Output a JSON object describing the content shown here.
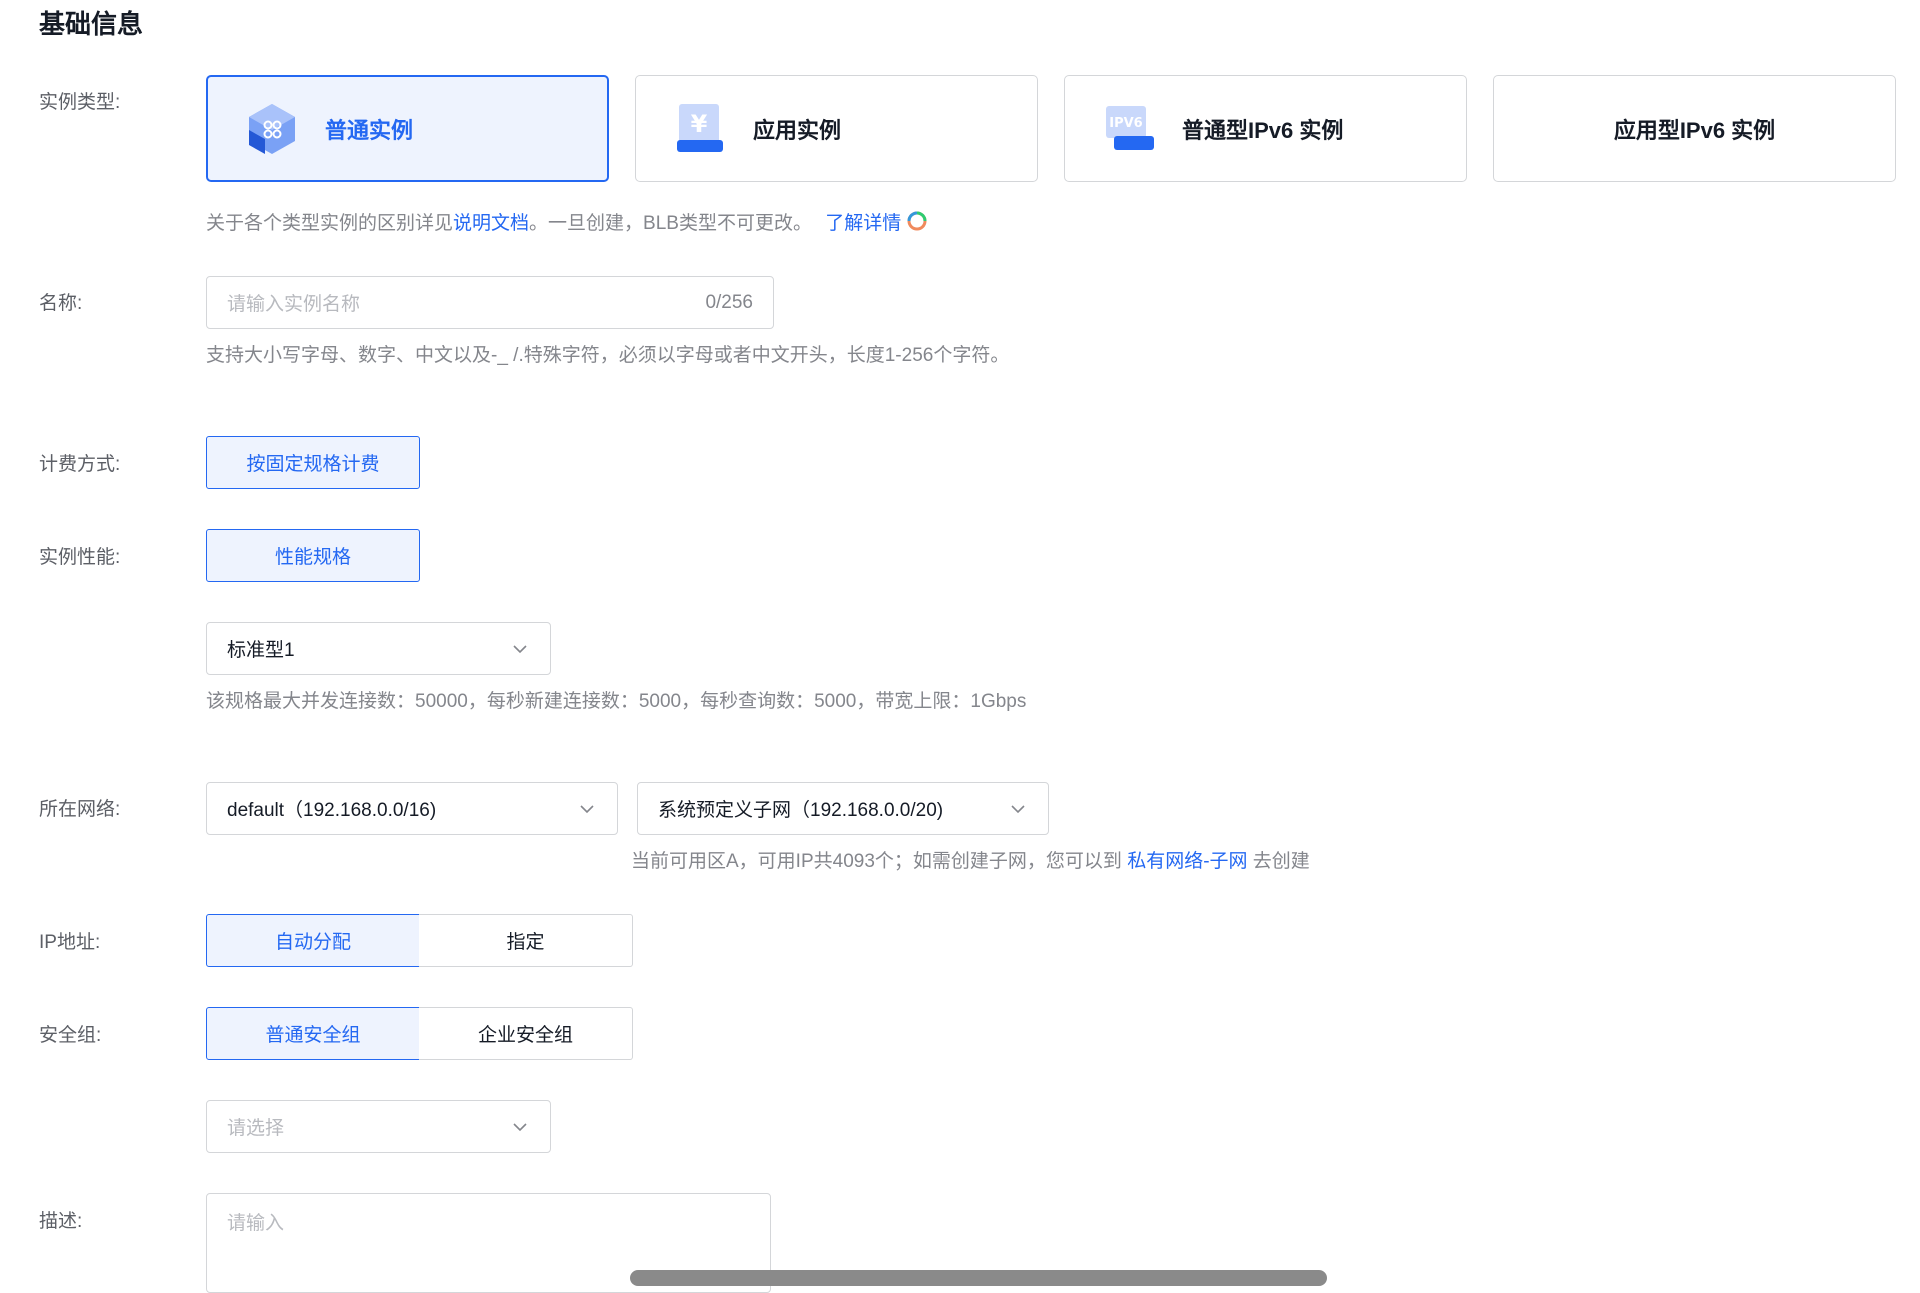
{
  "section_title": "基础信息",
  "labels": {
    "instance_type": "实例类型:",
    "name": "名称:",
    "billing": "计费方式:",
    "performance": "实例性能:",
    "network": "所在网络:",
    "ip": "IP地址:",
    "security": "安全组:",
    "description": "描述:"
  },
  "instance_types": [
    {
      "label": "普通实例",
      "icon": "cube-icon",
      "selected": true
    },
    {
      "label": "应用实例",
      "icon": "yuan-icon",
      "selected": false
    },
    {
      "label": "普通型IPv6 实例",
      "icon": "ipv6-icon",
      "selected": false
    },
    {
      "label": "应用型IPv6 实例",
      "icon": "",
      "selected": false
    }
  ],
  "instance_hint": {
    "prefix": "关于各个类型实例的区别详见",
    "doc_link": "说明文档",
    "middle": "。一旦创建，BLB类型不可更改。",
    "more_link": "了解详情"
  },
  "name_field": {
    "placeholder": "请输入实例名称",
    "counter": "0/256",
    "hint": "支持大小写字母、数字、中文以及-_ /.特殊字符，必须以字母或者中文开头，长度1-256个字符。"
  },
  "billing": {
    "option": "按固定规格计费"
  },
  "performance": {
    "option": "性能规格",
    "spec_value": "标准型1",
    "spec_hint": "该规格最大并发连接数：50000，每秒新建连接数：5000，每秒查询数：5000，带宽上限：1Gbps"
  },
  "network": {
    "vpc_value": "default（192.168.0.0/16)",
    "subnet_value": "系统预定义子网（192.168.0.0/20)",
    "hint_prefix": "当前可用区A，可用IP共4093个；如需创建子网，您可以到",
    "hint_link": "私有网络-子网",
    "hint_suffix": "去创建"
  },
  "ip": {
    "auto": "自动分配",
    "manual": "指定"
  },
  "security": {
    "normal": "普通安全组",
    "enterprise": "企业安全组",
    "placeholder": "请选择"
  },
  "description": {
    "placeholder": "请输入"
  },
  "colors": {
    "accent": "#2468f2",
    "selected_bg": "#eef3fe",
    "border": "#d4d6d9",
    "muted": "#84868c"
  }
}
